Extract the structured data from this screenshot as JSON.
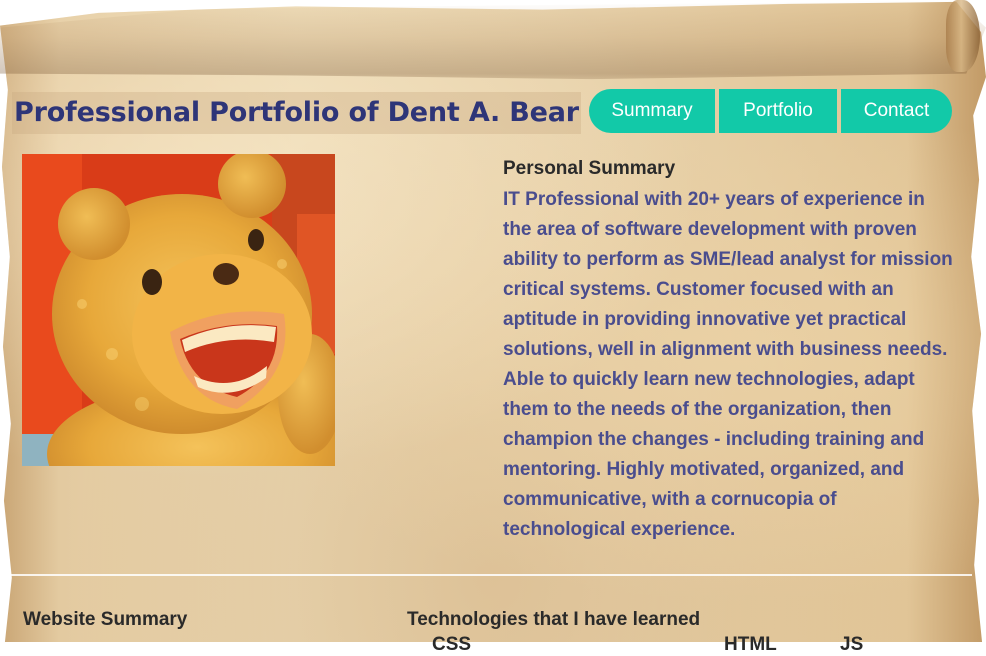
{
  "header": {
    "title": "Professional Portfolio of Dent A. Bear"
  },
  "nav": {
    "items": [
      {
        "label": "Summary"
      },
      {
        "label": "Portfolio"
      },
      {
        "label": "Contact"
      }
    ],
    "color": "#12c9a8"
  },
  "profile": {
    "photo": "teddy-bear-photo"
  },
  "summary": {
    "heading": "Personal Summary",
    "body": "IT Professional with 20+ years of experience in the area of software development with proven ability to perform as SME/lead analyst for mission critical systems. Customer focused with an aptitude in providing innovative yet practical solutions, well in alignment with business needs. Able to quickly learn new technologies, adapt them to the needs of the organization, then champion the changes - including training and mentoring. Highly motivated, organized, and communicative, with a cornucopia of technological experience."
  },
  "website_summary": {
    "heading": "Website Summary"
  },
  "technologies": {
    "heading": "Technologies that I have learned",
    "items": [
      "CSS",
      "HTML",
      "JS"
    ]
  },
  "colors": {
    "title": "#2e3578",
    "body_text": "#4a4d8e",
    "parchment": "#e8d2ab"
  }
}
